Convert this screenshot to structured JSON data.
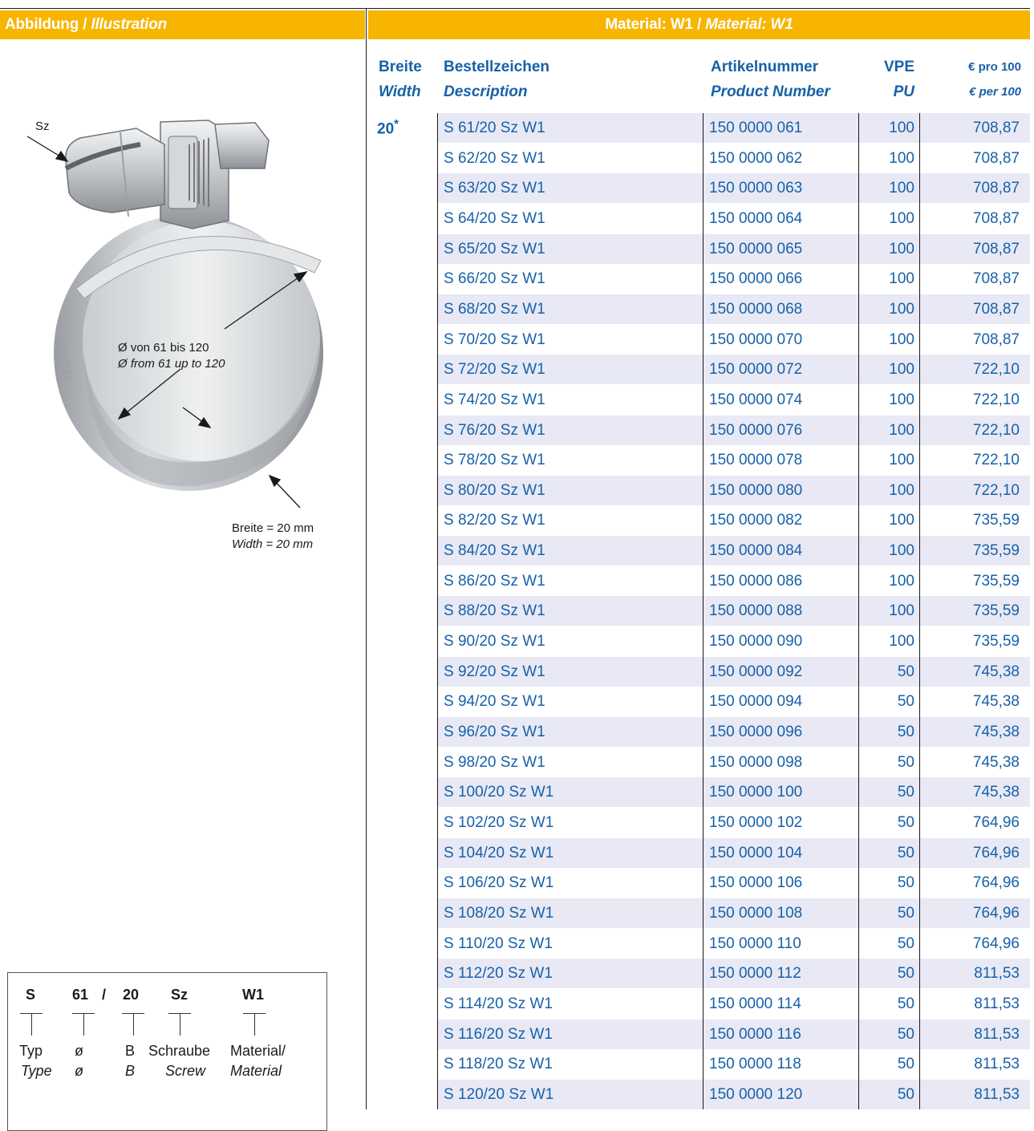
{
  "header": {
    "left": "Abbildung / ",
    "left_italic": "Illustration",
    "right": "Material: W1 / ",
    "right_italic": "Material: W1"
  },
  "illustration": {
    "label_sz": "Sz",
    "diameter_de": "Ø von 61 bis 120",
    "diameter_en": "Ø from 61 up to 120",
    "width_de": "Breite = 20 mm",
    "width_en": "Width = 20 mm",
    "band_imprint": "NORMA"
  },
  "code_legend": {
    "codes": [
      "S",
      "61",
      "/",
      "20",
      "Sz",
      "W1"
    ],
    "labels_de": [
      "Typ",
      "ø",
      "B",
      "Schraube",
      "Material/"
    ],
    "labels_en": [
      "Type",
      "ø",
      "B",
      "Screw",
      "Material"
    ]
  },
  "table": {
    "columns": [
      {
        "de": "Breite",
        "en": "Width"
      },
      {
        "de": "Bestellzeichen",
        "en": "Description"
      },
      {
        "de": "Artikelnummer",
        "en": "Product Number"
      },
      {
        "de": "VPE",
        "en": "PU"
      },
      {
        "de": "€ pro 100",
        "en": "€ per 100"
      }
    ],
    "width_value": "20",
    "width_marker": "*",
    "rows": [
      [
        "S 61/20 Sz W1",
        "150 0000 061",
        "100",
        "708,87"
      ],
      [
        "S 62/20 Sz W1",
        "150 0000 062",
        "100",
        "708,87"
      ],
      [
        "S 63/20 Sz W1",
        "150 0000 063",
        "100",
        "708,87"
      ],
      [
        "S 64/20 Sz W1",
        "150 0000 064",
        "100",
        "708,87"
      ],
      [
        "S 65/20 Sz W1",
        "150 0000 065",
        "100",
        "708,87"
      ],
      [
        "S 66/20 Sz W1",
        "150 0000 066",
        "100",
        "708,87"
      ],
      [
        "S 68/20 Sz W1",
        "150 0000 068",
        "100",
        "708,87"
      ],
      [
        "S 70/20 Sz W1",
        "150 0000 070",
        "100",
        "708,87"
      ],
      [
        "S 72/20 Sz W1",
        "150 0000 072",
        "100",
        "722,10"
      ],
      [
        "S 74/20 Sz W1",
        "150 0000 074",
        "100",
        "722,10"
      ],
      [
        "S 76/20 Sz W1",
        "150 0000 076",
        "100",
        "722,10"
      ],
      [
        "S 78/20 Sz W1",
        "150 0000 078",
        "100",
        "722,10"
      ],
      [
        "S 80/20 Sz W1",
        "150 0000 080",
        "100",
        "722,10"
      ],
      [
        "S 82/20 Sz W1",
        "150 0000 082",
        "100",
        "735,59"
      ],
      [
        "S 84/20 Sz W1",
        "150 0000 084",
        "100",
        "735,59"
      ],
      [
        "S 86/20 Sz W1",
        "150 0000 086",
        "100",
        "735,59"
      ],
      [
        "S 88/20 Sz W1",
        "150 0000 088",
        "100",
        "735,59"
      ],
      [
        "S 90/20 Sz W1",
        "150 0000 090",
        "100",
        "735,59"
      ],
      [
        "S 92/20 Sz W1",
        "150 0000 092",
        "50",
        "745,38"
      ],
      [
        "S 94/20 Sz W1",
        "150 0000 094",
        "50",
        "745,38"
      ],
      [
        "S 96/20 Sz W1",
        "150 0000 096",
        "50",
        "745,38"
      ],
      [
        "S 98/20 Sz W1",
        "150 0000 098",
        "50",
        "745,38"
      ],
      [
        "S 100/20 Sz W1",
        "150 0000 100",
        "50",
        "745,38"
      ],
      [
        "S 102/20 Sz W1",
        "150 0000 102",
        "50",
        "764,96"
      ],
      [
        "S 104/20 Sz W1",
        "150 0000 104",
        "50",
        "764,96"
      ],
      [
        "S 106/20 Sz W1",
        "150 0000 106",
        "50",
        "764,96"
      ],
      [
        "S 108/20 Sz W1",
        "150 0000 108",
        "50",
        "764,96"
      ],
      [
        "S 110/20 Sz W1",
        "150 0000 110",
        "50",
        "764,96"
      ],
      [
        "S 112/20 Sz W1",
        "150 0000 112",
        "50",
        "811,53"
      ],
      [
        "S 114/20 Sz W1",
        "150 0000 114",
        "50",
        "811,53"
      ],
      [
        "S 116/20 Sz W1",
        "150 0000 116",
        "50",
        "811,53"
      ],
      [
        "S 118/20 Sz W1",
        "150 0000 118",
        "50",
        "811,53"
      ],
      [
        "S 120/20 Sz W1",
        "150 0000 120",
        "50",
        "811,53"
      ]
    ]
  },
  "colors": {
    "header_bg": "#f7b400",
    "header_text": "#ffffff",
    "table_text": "#1761a8",
    "row_alt": "#e8e9f5"
  }
}
